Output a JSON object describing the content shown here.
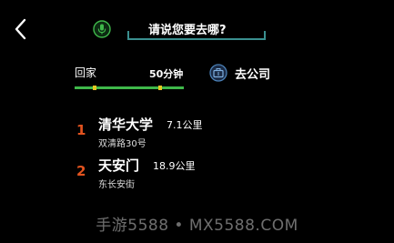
{
  "header": {
    "back_icon": "chevron-left-icon",
    "mic_icon": "microphone-icon",
    "search_prompt": "请说您要去哪?"
  },
  "shortcuts": {
    "home": {
      "label": "回家",
      "duration": "50分钟"
    },
    "company": {
      "icon": "briefcase-icon",
      "label": "去公司"
    }
  },
  "results": [
    {
      "index": "1",
      "name": "清华大学",
      "distance": "7.1公里",
      "address": "双清路30号"
    },
    {
      "index": "2",
      "name": "天安门",
      "distance": "18.9公里",
      "address": "东长安街"
    }
  ],
  "colors": {
    "background": "#000000",
    "accent_green": "#3fb84a",
    "traffic_yellow": "#e5c722",
    "index_orange": "#e2531f",
    "search_border": "#3a8f8f",
    "company_icon_blue": "#4a7fb5"
  },
  "watermark": "手游5588 • MX5588.COM"
}
